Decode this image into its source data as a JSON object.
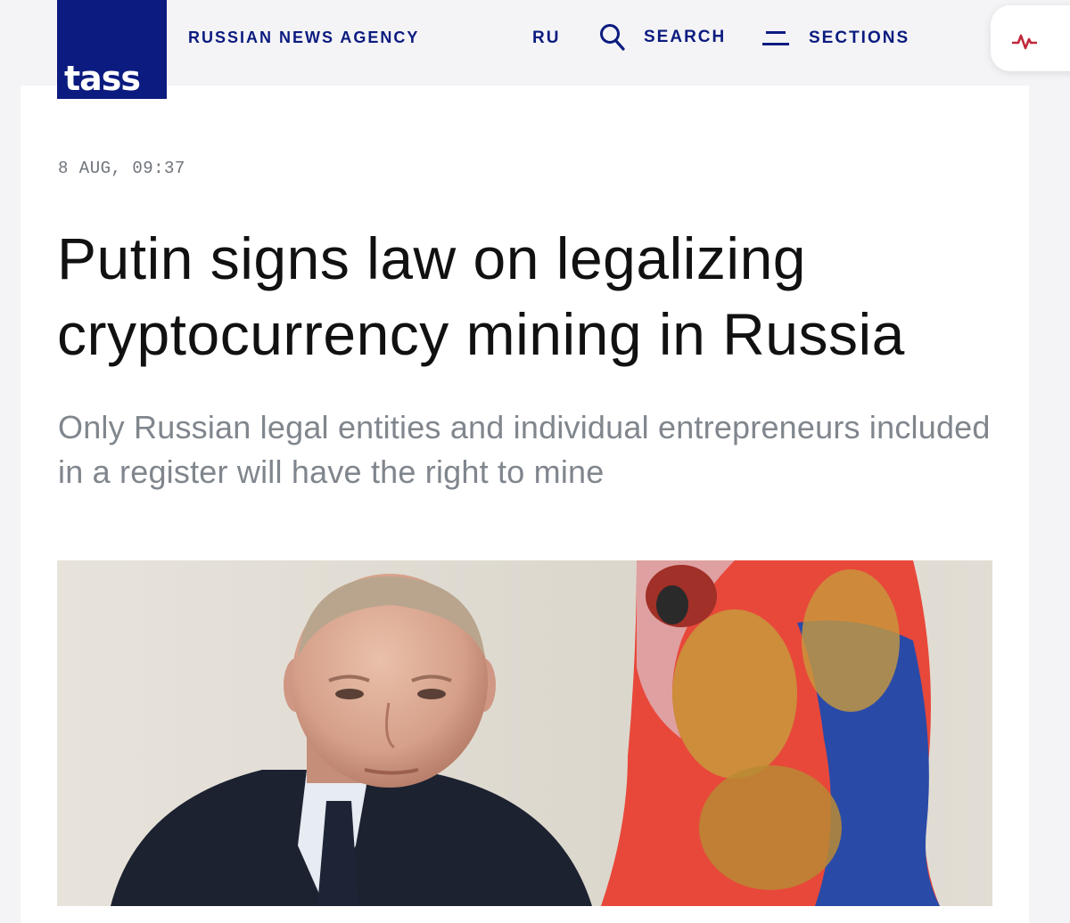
{
  "header": {
    "logo_text": "tass",
    "agency": "RUSSIAN NEWS AGENCY",
    "nav": {
      "lang": "RU",
      "search": "SEARCH",
      "sections": "SECTIONS"
    },
    "icons": [
      "search-icon",
      "menu-icon",
      "pulse-icon"
    ]
  },
  "article": {
    "date": "8 AUG, 09:37",
    "title": "Putin signs law on legalizing cryptocurrency mining in Russia",
    "lead": "Only Russian legal entities and individual entrepreneurs included in a register will have the right to mine"
  },
  "colors": {
    "brand": "#0b1b7f",
    "pulse": "#c0283a",
    "date": "#6e737a",
    "lead": "#80868d"
  }
}
